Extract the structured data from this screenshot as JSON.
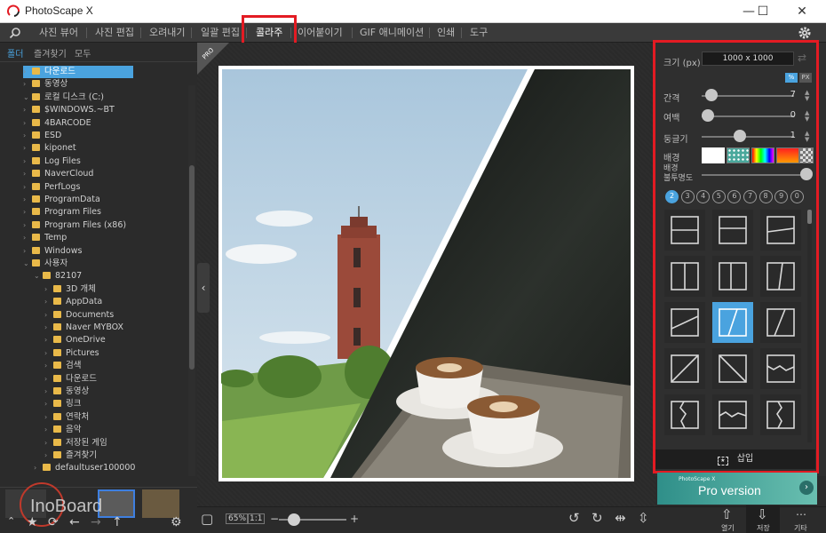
{
  "window": {
    "title": "PhotoScape X",
    "minimize": "—",
    "maximize": "☐",
    "close": "✕"
  },
  "menu": {
    "items": [
      "사진 뷰어",
      "사진 편집",
      "오려내기",
      "일괄 편집",
      "콜라주",
      "이어붙이기",
      "GIF 애니메이션",
      "인쇄",
      "도구"
    ],
    "active": "콜라주"
  },
  "left_panel": {
    "tabs": [
      "폴더",
      "즐겨찾기",
      "모두"
    ],
    "tree": [
      {
        "label": "다운로드",
        "depth": 1,
        "selected": true
      },
      {
        "label": "동영상",
        "depth": 1
      },
      {
        "label": "로컬 디스크 (C:)",
        "depth": 1,
        "expanded": true
      },
      {
        "label": "$WINDOWS.~BT",
        "depth": 2
      },
      {
        "label": "4BARCODE",
        "depth": 2
      },
      {
        "label": "ESD",
        "depth": 2
      },
      {
        "label": "kiponet",
        "depth": 2
      },
      {
        "label": "Log Files",
        "depth": 2
      },
      {
        "label": "NaverCloud",
        "depth": 2
      },
      {
        "label": "PerfLogs",
        "depth": 2
      },
      {
        "label": "ProgramData",
        "depth": 2
      },
      {
        "label": "Program Files",
        "depth": 2
      },
      {
        "label": "Program Files (x86)",
        "depth": 2
      },
      {
        "label": "Temp",
        "depth": 2
      },
      {
        "label": "Windows",
        "depth": 2
      },
      {
        "label": "사용자",
        "depth": 2,
        "expanded": true
      },
      {
        "label": "82107",
        "depth": 3,
        "expanded": true
      },
      {
        "label": "3D 개체",
        "depth": 4
      },
      {
        "label": "AppData",
        "depth": 4
      },
      {
        "label": "Documents",
        "depth": 4
      },
      {
        "label": "Naver MYBOX",
        "depth": 4
      },
      {
        "label": "OneDrive",
        "depth": 4
      },
      {
        "label": "Pictures",
        "depth": 4
      },
      {
        "label": "검색",
        "depth": 4
      },
      {
        "label": "다운로드",
        "depth": 4
      },
      {
        "label": "동영상",
        "depth": 4
      },
      {
        "label": "링크",
        "depth": 4
      },
      {
        "label": "연락처",
        "depth": 4
      },
      {
        "label": "음악",
        "depth": 4
      },
      {
        "label": "저장된 게임",
        "depth": 4
      },
      {
        "label": "즐겨찾기",
        "depth": 4
      },
      {
        "label": "defaultuser100000",
        "depth": 3
      }
    ],
    "watermark": "InoBoard"
  },
  "right_panel": {
    "size_label": "크기 (px)",
    "size_value": "1000 x 1000",
    "unit_percent": "%",
    "unit_px": "PX",
    "spacing_label": "간격",
    "spacing_value": "7",
    "margin_label": "여백",
    "margin_value": "0",
    "round_label": "둥글기",
    "round_value": "1",
    "bg_label": "배경",
    "bg_opacity_label": "배경\n불투명도",
    "photo_counts": [
      "2",
      "3",
      "4",
      "5",
      "6",
      "7",
      "8",
      "9",
      "0"
    ],
    "insert_label": "삽입",
    "pro_small": "PhotoScape X",
    "pro_main": "Pro version"
  },
  "bottom": {
    "zoom": "65%",
    "one_to_one": "1:1",
    "minus": "−",
    "plus": "+"
  },
  "right_bottom": {
    "open": "열기",
    "save": "저장",
    "more": "기타"
  },
  "colors": {
    "accent": "#4aa3df",
    "highlight": "#e31b23",
    "panel": "#2f2f2f"
  }
}
